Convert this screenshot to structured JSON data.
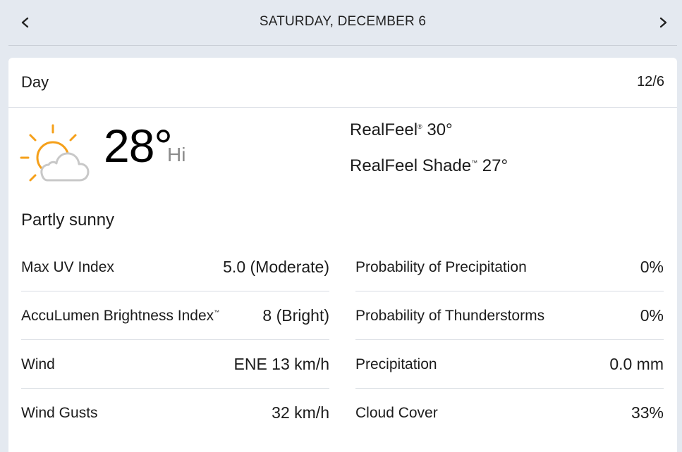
{
  "header": {
    "date_title": "SATURDAY, DECEMBER 6",
    "prev_icon": "chevron-left-icon",
    "next_icon": "chevron-right-icon"
  },
  "card": {
    "title": "Day",
    "short_date": "12/6",
    "icon": "partly-sunny-icon",
    "temperature": "28°",
    "temp_label": "Hi",
    "realfeel_label": "RealFeel",
    "realfeel_mark": "®",
    "realfeel_value": "30°",
    "realfeel_shade_label": "RealFeel Shade",
    "realfeel_shade_mark": "™",
    "realfeel_shade_value": "27°",
    "phrase": "Partly sunny",
    "colors": {
      "sun": "#f5a01a",
      "cloud": "#c8c8c8"
    }
  },
  "details_left": [
    {
      "label": "Max UV Index",
      "mark": "",
      "value": "5.0 (Moderate)"
    },
    {
      "label": "AccuLumen Brightness Index",
      "mark": "™",
      "value": "8 (Bright)"
    },
    {
      "label": "Wind",
      "mark": "",
      "value": "ENE 13 km/h"
    },
    {
      "label": "Wind Gusts",
      "mark": "",
      "value": "32 km/h"
    }
  ],
  "details_right": [
    {
      "label": "Probability of Precipitation",
      "value": "0%"
    },
    {
      "label": "Probability of Thunderstorms",
      "value": "0%"
    },
    {
      "label": "Precipitation",
      "value": "0.0 mm"
    },
    {
      "label": "Cloud Cover",
      "value": "33%"
    }
  ]
}
